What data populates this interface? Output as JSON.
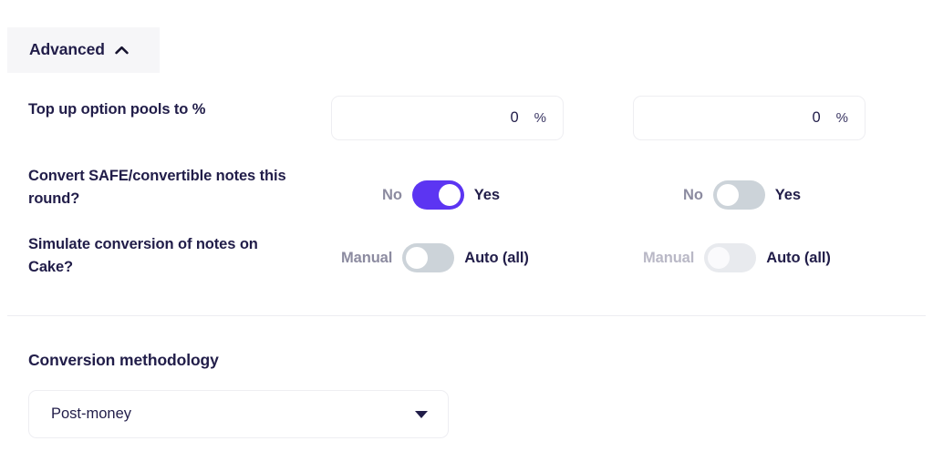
{
  "panel": {
    "advanced": {
      "label": "Advanced",
      "expanded": true,
      "chevron_icon": "chevron-up-icon"
    },
    "rows": [
      {
        "label": "Top up option pools to %",
        "type": "number",
        "columns": [
          {
            "value": "0",
            "unit": "%"
          },
          {
            "value": "0",
            "unit": "%"
          }
        ]
      },
      {
        "label": "Convert SAFE/convertible notes this round?",
        "type": "toggle",
        "columns": [
          {
            "off_label": "No",
            "on_label": "Yes",
            "state": "on",
            "muted": false
          },
          {
            "off_label": "No",
            "on_label": "Yes",
            "state": "off",
            "muted": false
          }
        ]
      },
      {
        "label": "Simulate conversion of notes on Cake?",
        "type": "toggle",
        "columns": [
          {
            "off_label": "Manual",
            "on_label": "Auto (all)",
            "state": "off",
            "muted": false
          },
          {
            "off_label": "Manual",
            "on_label": "Auto (all)",
            "state": "off",
            "muted": true
          }
        ]
      }
    ]
  },
  "conversion": {
    "title": "Conversion methodology",
    "selected": "Post-money",
    "caret_icon": "caret-down-icon"
  },
  "colors": {
    "accent": "#5c35f2",
    "text": "#211d49",
    "muted_text": "#8c8ba0",
    "faded_text": "#b9b8c6",
    "track_off": "#ccd3d9",
    "track_muted": "#e8eaee",
    "border": "#eeeef2",
    "header_bg": "#f6f6f8",
    "divider": "#ededf1"
  }
}
